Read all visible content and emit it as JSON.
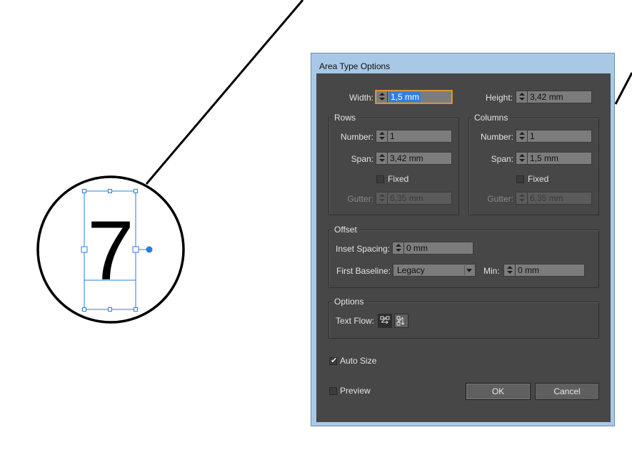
{
  "artboard": {
    "glyph": "7",
    "handle_color": "#2a7be0"
  },
  "dialog": {
    "title": "Area Type Options",
    "width": {
      "label": "Width:",
      "value": "1,5 mm"
    },
    "height": {
      "label": "Height:",
      "value": "3,42 mm"
    },
    "rows": {
      "title": "Rows",
      "number": {
        "label": "Number:",
        "value": "1"
      },
      "span": {
        "label": "Span:",
        "value": "3,42 mm"
      },
      "fixed_label": "Fixed",
      "gutter": {
        "label": "Gutter:",
        "value": "6,35 mm"
      }
    },
    "columns": {
      "title": "Columns",
      "number": {
        "label": "Number:",
        "value": "1"
      },
      "span": {
        "label": "Span:",
        "value": "1,5 mm"
      },
      "fixed_label": "Fixed",
      "gutter": {
        "label": "Gutter:",
        "value": "6,35 mm"
      }
    },
    "offset": {
      "title": "Offset",
      "inset": {
        "label": "Inset Spacing:",
        "value": "0 mm"
      },
      "first_baseline": {
        "label": "First Baseline:",
        "value": "Legacy"
      },
      "min": {
        "label": "Min:",
        "value": "0 mm"
      }
    },
    "options": {
      "title": "Options",
      "text_flow_label": "Text Flow:",
      "text_flow_icons": [
        "text-flow-rows-icon",
        "text-flow-columns-icon"
      ]
    },
    "auto_size": {
      "label": "Auto Size",
      "checked": true
    },
    "preview": {
      "label": "Preview",
      "checked": false
    },
    "ok_label": "OK",
    "cancel_label": "Cancel"
  }
}
